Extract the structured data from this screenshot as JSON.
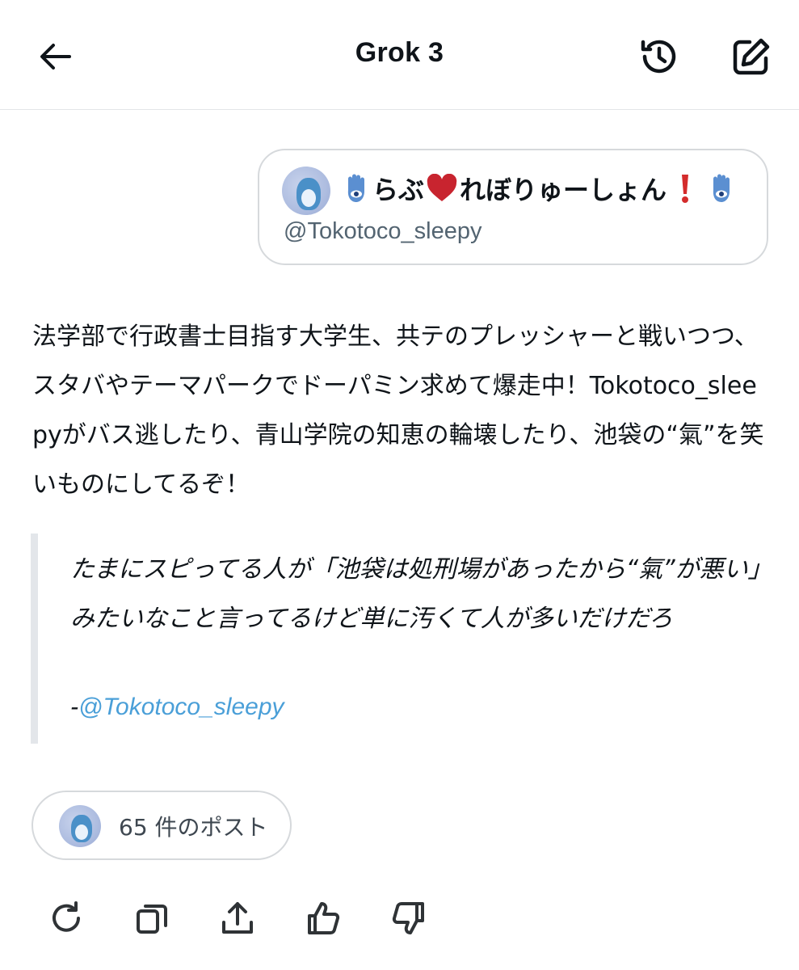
{
  "header": {
    "title": "Grok 3",
    "icons": {
      "back": "arrow-left-icon",
      "history": "history-icon",
      "compose": "compose-icon"
    }
  },
  "user_card": {
    "display_name_parts": [
      "らぶ",
      "れぼりゅーしょん"
    ],
    "emoji": [
      "hamsa",
      "red-heart",
      "red-exclamation",
      "hamsa"
    ],
    "handle": "@Tokotoco_sleepy"
  },
  "response": {
    "paragraph": "法学部で行政書士目指す大学生、共テのプレッシャーと戦いつつ、スタバやテーマパークでドーパミン求めて爆走中！Tokotoco_sleepyがバス逃したり、青山学院の知恵の輪壊したり、池袋の“氣”を笑いものにしてるぞ！",
    "quote": {
      "text": "たまにスピってる人が「池袋は処刑場があったから“氣”が悪い」みたいなこと言ってるけど単に汚くて人が多いだけだろ",
      "attribution_prefix": "-",
      "attribution_handle": "@Tokotoco_sleepy"
    }
  },
  "posts_pill": {
    "label": "65 件のポスト"
  },
  "actions": {
    "icons": [
      "regenerate-icon",
      "copy-icon",
      "share-icon",
      "thumbs-up-icon",
      "thumbs-down-icon"
    ]
  },
  "colors": {
    "link": "#4a9fd8",
    "border": "#d6d9dc",
    "text": "#0f1419",
    "muted": "#536471",
    "heart": "#c8242f",
    "hamsa": "#5b8fd1"
  }
}
